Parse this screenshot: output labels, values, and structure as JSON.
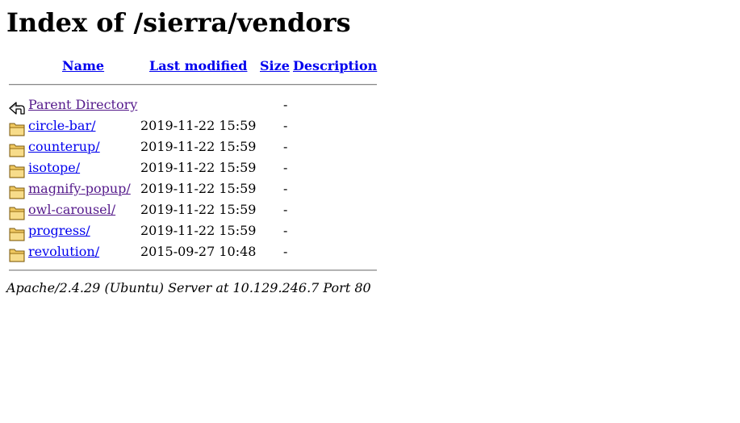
{
  "page": {
    "title": "Index of /sierra/vendors"
  },
  "table": {
    "headers": {
      "name": "Name",
      "last_modified": "Last modified",
      "size": "Size",
      "description": "Description"
    },
    "parent": {
      "label": "Parent Directory",
      "date": "",
      "size": "-",
      "icon": "back-arrow-icon"
    },
    "rows": [
      {
        "name": "circle-bar/",
        "date": "2019-11-22 15:59",
        "size": "-",
        "icon": "folder-icon",
        "visited": false
      },
      {
        "name": "counterup/",
        "date": "2019-11-22 15:59",
        "size": "-",
        "icon": "folder-icon",
        "visited": false
      },
      {
        "name": "isotope/",
        "date": "2019-11-22 15:59",
        "size": "-",
        "icon": "folder-icon",
        "visited": false
      },
      {
        "name": "magnify-popup/",
        "date": "2019-11-22 15:59",
        "size": "-",
        "icon": "folder-icon",
        "visited": true
      },
      {
        "name": "owl-carousel/",
        "date": "2019-11-22 15:59",
        "size": "-",
        "icon": "folder-icon",
        "visited": true
      },
      {
        "name": "progress/",
        "date": "2019-11-22 15:59",
        "size": "-",
        "icon": "folder-icon",
        "visited": false
      },
      {
        "name": "revolution/",
        "date": "2015-09-27 10:48",
        "size": "-",
        "icon": "folder-icon",
        "visited": false
      }
    ]
  },
  "footer": {
    "signature": "Apache/2.4.29 (Ubuntu) Server at 10.129.246.7 Port 80"
  },
  "colors": {
    "link": "#0000ee",
    "visited_link": "#551a8b",
    "folder_fill": "#f0c860",
    "folder_stroke": "#7a5a10"
  }
}
